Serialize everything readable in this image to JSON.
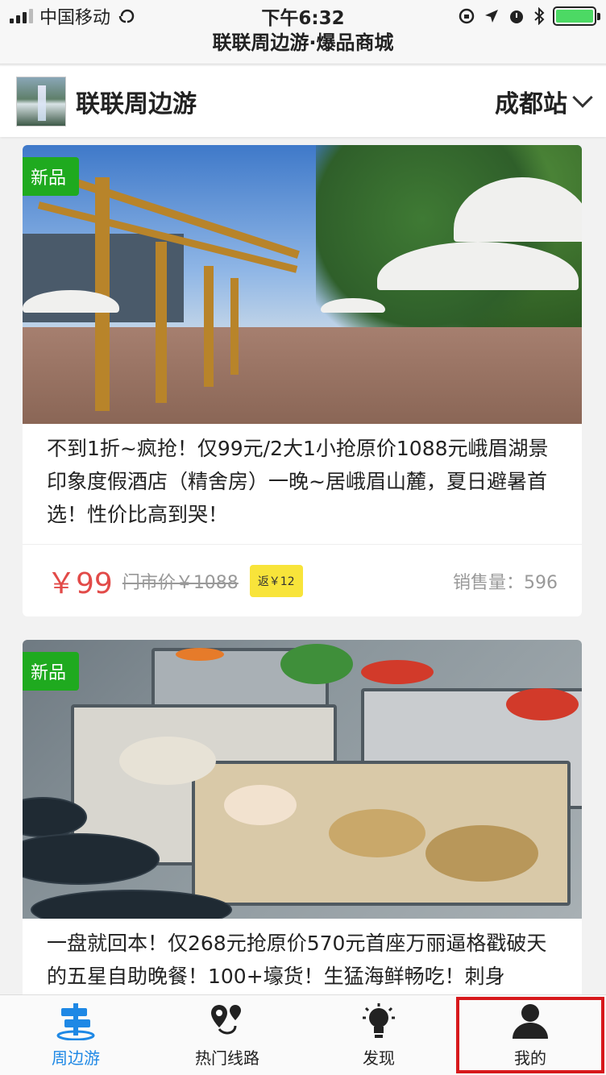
{
  "status_bar": {
    "carrier": "中国移动",
    "time": "下午6:32"
  },
  "nav": {
    "title": "联联周边游·爆品商城"
  },
  "header": {
    "brand": "联联周边游",
    "station": "成都站"
  },
  "products": [
    {
      "badge": "新品",
      "title": "不到1折~疯抢！仅99元/2大1小抢原价1088元峨眉湖景印象度假酒店（精舍房）一晚~居峨眉山麓，夏日避暑首选！性价比高到哭！",
      "price": "￥99",
      "original_price": "门市价￥1088",
      "rebate": "返￥12",
      "sales": "销售量：596"
    },
    {
      "badge": "新品",
      "title": "一盘就回本！仅268元抢原价570元首座万丽逼格戳破天的五星自助晚餐！100+壕货！生猛海鲜畅吃！刺身"
    }
  ],
  "tabs": [
    {
      "label": "周边游",
      "icon": "signpost-icon",
      "active": true
    },
    {
      "label": "热门线路",
      "icon": "route-pin-icon",
      "active": false
    },
    {
      "label": "发现",
      "icon": "lightbulb-icon",
      "active": false
    },
    {
      "label": "我的",
      "icon": "user-icon",
      "active": false
    }
  ],
  "colors": {
    "price": "#e24a48",
    "badge": "#1faa1f",
    "rebate": "#f8e43a",
    "tab_active": "#1e88e5",
    "highlight_box": "#d7191c"
  }
}
